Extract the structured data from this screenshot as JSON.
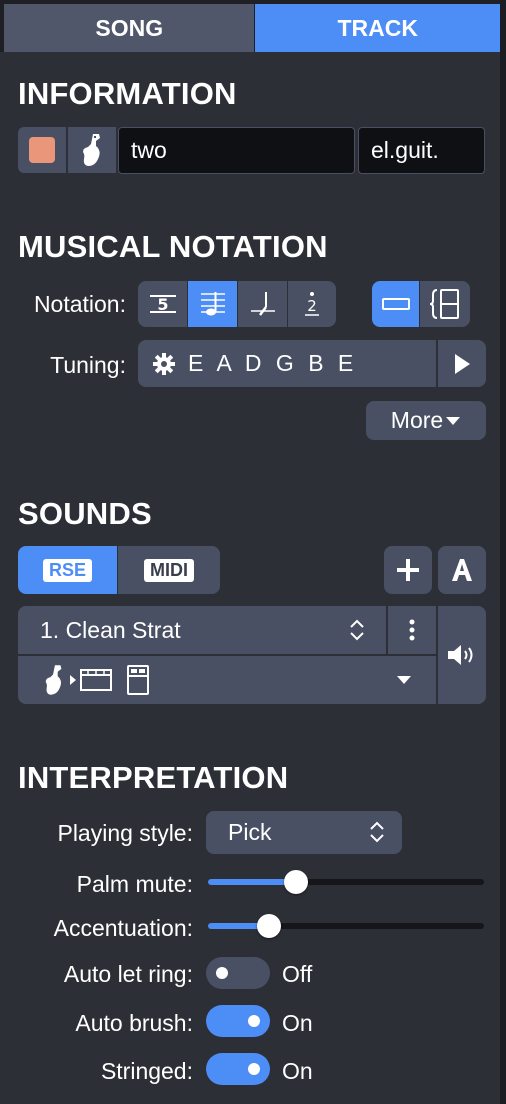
{
  "tabs": {
    "song": "SONG",
    "track": "TRACK"
  },
  "information": {
    "title": "INFORMATION",
    "track_color": "#e9967a",
    "track_name": "two",
    "instrument_short": "el.guit."
  },
  "notation": {
    "title": "MUSICAL NOTATION",
    "notation_label": "Notation:",
    "tuning_label": "Tuning:",
    "tuning_value": "E A D G B E",
    "more_label": "More"
  },
  "sounds": {
    "title": "SOUNDS",
    "rse_label": "RSE",
    "midi_label": "MIDI",
    "sound_name": "1. Clean Strat"
  },
  "interpretation": {
    "title": "INTERPRETATION",
    "playing_style_label": "Playing style:",
    "playing_style_value": "Pick",
    "palm_mute_label": "Palm mute:",
    "palm_mute_level": 0.32,
    "accentuation_label": "Accentuation:",
    "accentuation_level": 0.22,
    "auto_let_ring_label": "Auto let ring:",
    "auto_let_ring_state": "Off",
    "auto_brush_label": "Auto brush:",
    "auto_brush_state": "On",
    "stringed_label": "Stringed:",
    "stringed_state": "On"
  },
  "colors": {
    "accent": "#4c8df6",
    "panel": "#2d2f37",
    "control": "#4a5063"
  }
}
